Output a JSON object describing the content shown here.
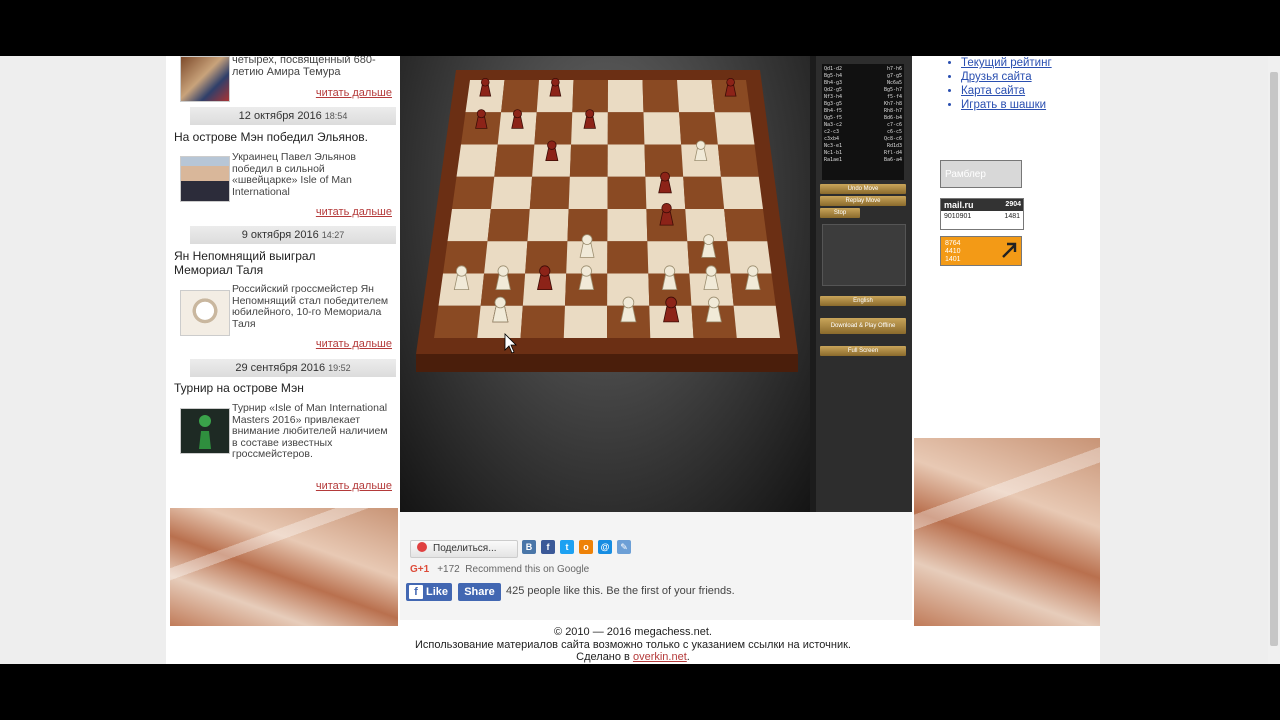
{
  "news": [
    {
      "text_tail": "четырех, посвященный 680-летию Амира Темура",
      "more": "читать дальше"
    },
    {
      "date": "12 октября 2016",
      "time": "18:54",
      "title": "На острове Мэн победил Эльянов.",
      "text": "Украинец Павел Эльянов победил в сильной «швейцарке» Isle of Man International",
      "more": "читать дальше"
    },
    {
      "date": "9 октября 2016",
      "time": "14:27",
      "title": "Ян Непомнящий выиграл Мемориал Таля",
      "text": "Российский гроссмейстер Ян Непомнящий стал победителем юбилейного, 10-го Мемориала Таля",
      "more": "читать дальше"
    },
    {
      "date": "29 сентября 2016",
      "time": "19:52",
      "title": "Турнир на острове Мэн",
      "text": "Турнир «Isle of Man International Masters 2016» привлекает внимание любителей наличием в составе известных гроссмейстеров.",
      "more": "читать дальше"
    }
  ],
  "sidebar_links": [
    "Текущий рейтинг",
    "Друзья сайта",
    "Карта сайта",
    "Играть в шашки"
  ],
  "counters": {
    "rambler": "Рамблер",
    "mailru": {
      "brand": "mail.ru",
      "a": "2904",
      "b": "9010901",
      "c": "1481"
    },
    "liveinternet": {
      "a": "8764",
      "b": "4410",
      "c": "1401"
    }
  },
  "share": {
    "button": "Поделиться...",
    "social_letters": [
      "B",
      "f",
      "t",
      "o",
      "@",
      "✎"
    ],
    "gplus_label": "G+1",
    "gplus_count": "+172",
    "gplus_text": "Recommend this on Google",
    "fb_like": "Like",
    "fb_share": "Share",
    "fb_text": "425 people like this. Be the first of your friends."
  },
  "footer": {
    "copyright": "© 2010 — 2016 megachess.net.",
    "notice": "Использование материалов сайта возможно только с указанием ссылки на источник.",
    "made_by_prefix": "Сделано в",
    "made_by_link": "overkin.net",
    "made_by_suffix": "."
  },
  "game": {
    "moves": [
      [
        "Qd1-d2",
        "h7-h6"
      ],
      [
        "Bg5-h4",
        "g7-g5"
      ],
      [
        "Bh4-g3",
        "Nc6a5"
      ],
      [
        "Qd2-g5",
        "Bg5-h7"
      ],
      [
        "Nf3-h4",
        "f5-f4"
      ],
      [
        "Bg3-g5",
        "Kh7-h8"
      ],
      [
        "Bh4-f5",
        "Rh8-h7"
      ],
      [
        "Qg5-f5",
        "Bd6-b4"
      ],
      [
        "Na3-c2",
        "c7-c6"
      ],
      [
        "c2-c3",
        "c6-c5"
      ],
      [
        "c3xb4",
        "Qc8-c6"
      ],
      [
        "Nc3-e1",
        "Rd1d3"
      ],
      [
        "Nc1-b1",
        "Rfl-d4"
      ],
      [
        "Ra1ae1",
        "Ba6-a4"
      ]
    ],
    "buttons": [
      "Undo Move",
      "Replay Move",
      "Stop",
      "English",
      "Download & Play Offline",
      "Full Screen"
    ],
    "pieces": [
      {
        "f": 1,
        "r": 8,
        "c": "dark"
      },
      {
        "f": 3,
        "r": 8,
        "c": "dark"
      },
      {
        "f": 8,
        "r": 8,
        "c": "dark"
      },
      {
        "f": 1,
        "r": 7,
        "c": "dark"
      },
      {
        "f": 2,
        "r": 7,
        "c": "dark"
      },
      {
        "f": 4,
        "r": 7,
        "c": "dark"
      },
      {
        "f": 3,
        "r": 6,
        "c": "dark"
      },
      {
        "f": 6,
        "r": 5,
        "c": "dark"
      },
      {
        "f": 6,
        "r": 4,
        "c": "dark"
      },
      {
        "f": 3,
        "r": 2,
        "c": "dark"
      },
      {
        "f": 2,
        "r": 1,
        "c": "dark"
      },
      {
        "f": 6,
        "r": 1,
        "c": "dark"
      },
      {
        "f": 7,
        "r": 6,
        "c": "light"
      },
      {
        "f": 4,
        "r": 3,
        "c": "light"
      },
      {
        "f": 7,
        "r": 3,
        "c": "light"
      },
      {
        "f": 1,
        "r": 2,
        "c": "light"
      },
      {
        "f": 2,
        "r": 2,
        "c": "light"
      },
      {
        "f": 4,
        "r": 2,
        "c": "light"
      },
      {
        "f": 6,
        "r": 2,
        "c": "light"
      },
      {
        "f": 7,
        "r": 2,
        "c": "light"
      },
      {
        "f": 8,
        "r": 2,
        "c": "light"
      },
      {
        "f": 2,
        "r": 1,
        "c": "light"
      },
      {
        "f": 5,
        "r": 1,
        "c": "light"
      },
      {
        "f": 7,
        "r": 1,
        "c": "light"
      }
    ]
  }
}
